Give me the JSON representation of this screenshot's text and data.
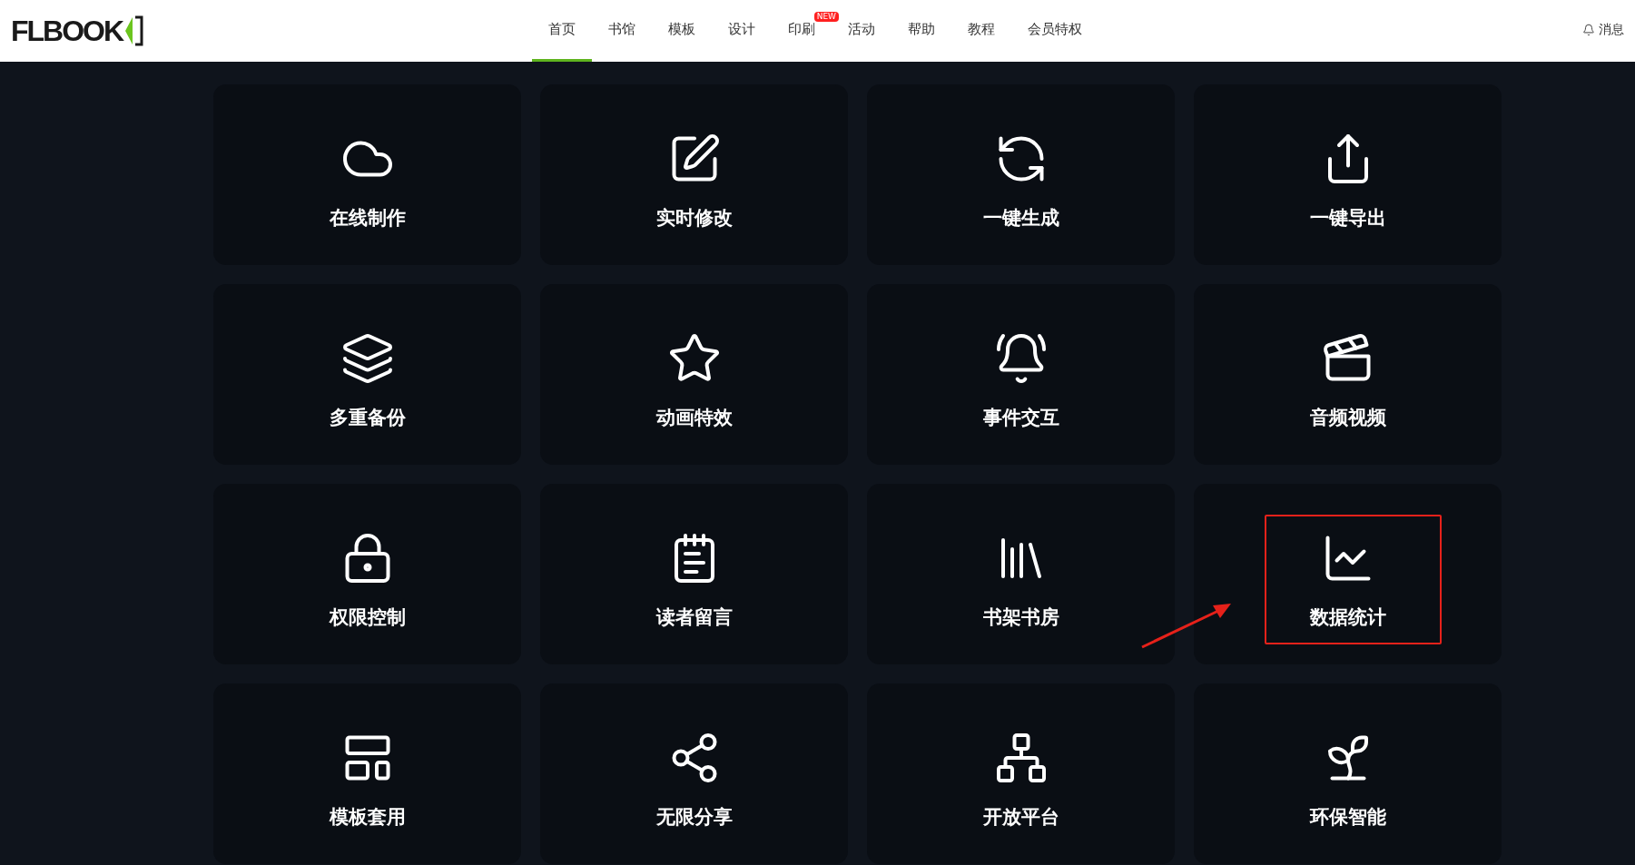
{
  "header": {
    "logo": "FLBOOK",
    "nav": [
      {
        "label": "首页",
        "selected": true
      },
      {
        "label": "书馆",
        "selected": false
      },
      {
        "label": "模板",
        "selected": false
      },
      {
        "label": "设计",
        "selected": false
      },
      {
        "label": "印刷",
        "selected": false,
        "badge": "NEW"
      },
      {
        "label": "活动",
        "selected": false
      },
      {
        "label": "帮助",
        "selected": false
      },
      {
        "label": "教程",
        "selected": false
      },
      {
        "label": "会员特权",
        "selected": false
      }
    ],
    "messages": "消息"
  },
  "features": [
    {
      "label": "在线制作",
      "highlighted": false
    },
    {
      "label": "实时修改",
      "highlighted": false
    },
    {
      "label": "一键生成",
      "highlighted": false
    },
    {
      "label": "一键导出",
      "highlighted": false
    },
    {
      "label": "多重备份",
      "highlighted": false
    },
    {
      "label": "动画特效",
      "highlighted": false
    },
    {
      "label": "事件交互",
      "highlighted": false
    },
    {
      "label": "音频视频",
      "highlighted": false
    },
    {
      "label": "权限控制",
      "highlighted": false
    },
    {
      "label": "读者留言",
      "highlighted": false
    },
    {
      "label": "书架书房",
      "highlighted": false
    },
    {
      "label": "数据统计",
      "highlighted": true
    },
    {
      "label": "模板套用",
      "highlighted": false
    },
    {
      "label": "无限分享",
      "highlighted": false
    },
    {
      "label": "开放平台",
      "highlighted": false
    },
    {
      "label": "环保智能",
      "highlighted": false
    }
  ]
}
